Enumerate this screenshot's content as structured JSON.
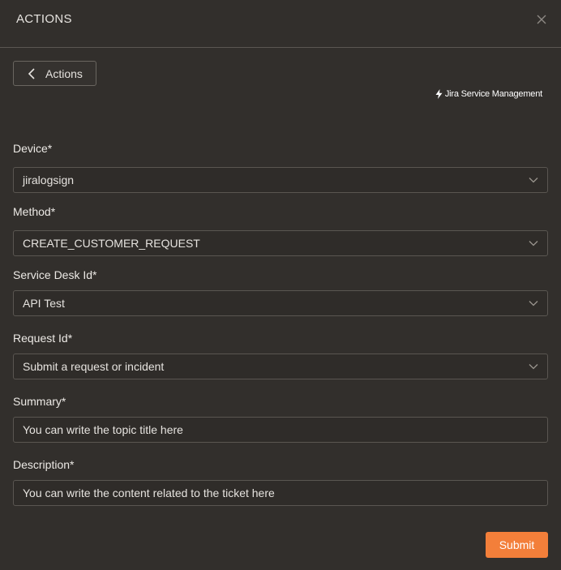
{
  "header": {
    "title": "ACTIONS",
    "close_icon": "close-icon"
  },
  "back_button": {
    "label": "Actions",
    "icon": "chevron-left-icon"
  },
  "brand": {
    "text": "Jira Service Management",
    "icon": "bolt-icon"
  },
  "form": {
    "device": {
      "label": "Device*",
      "value": "jiralogsign"
    },
    "method": {
      "label": "Method*",
      "value": "CREATE_CUSTOMER_REQUEST"
    },
    "service_desk": {
      "label": "Service Desk Id*",
      "value": "API Test"
    },
    "request": {
      "label": "Request Id*",
      "value": "Submit a request or incident"
    },
    "summary": {
      "label": "Summary*",
      "value": "You can write the topic title here"
    },
    "description": {
      "label": "Description*",
      "value": "You can write the content related to the ticket here"
    }
  },
  "submit_label": "Submit",
  "colors": {
    "background": "#322f2c",
    "accent": "#f37f3a",
    "border": "#5a5651"
  }
}
